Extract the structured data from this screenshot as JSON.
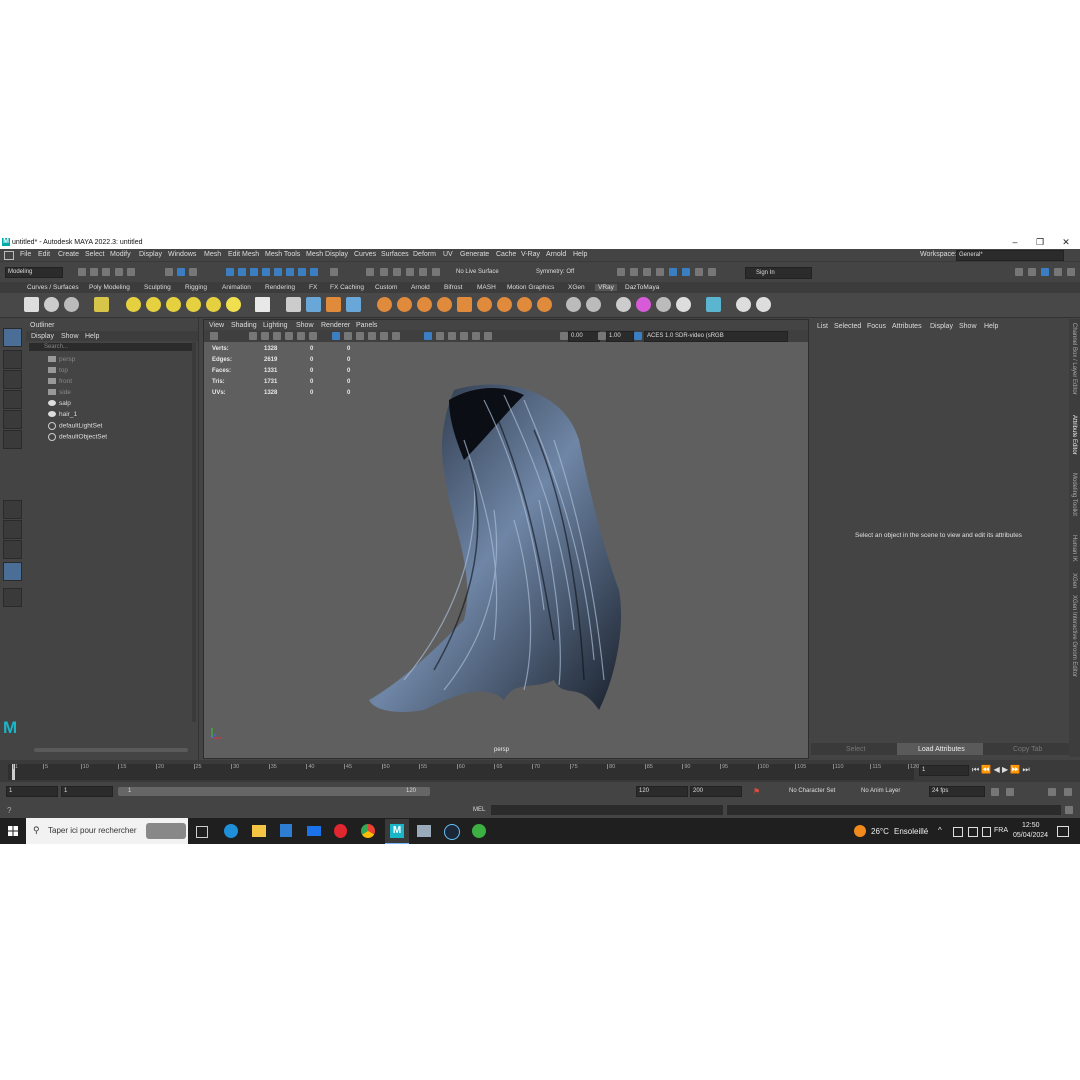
{
  "window": {
    "title": "untitled* - Autodesk MAYA 2022.3: untitled",
    "logo": "M",
    "controls": [
      "–",
      "❐",
      "✕"
    ]
  },
  "menubar": {
    "items": [
      "File",
      "Edit",
      "Create",
      "Select",
      "Modify",
      "Display",
      "Windows",
      "Mesh",
      "Edit Mesh",
      "Mesh Tools",
      "Mesh Display",
      "Curves",
      "Surfaces",
      "Deform",
      "UV",
      "Generate",
      "Cache",
      "V-Ray",
      "Arnold",
      "Help"
    ],
    "workspace_label": "Workspace:",
    "workspace_value": "General*"
  },
  "statusline": {
    "mode": "Modeling",
    "live_surface": "No Live Surface",
    "symmetry": "Symmetry: Off",
    "sign_in": "Sign In"
  },
  "shelf": {
    "tabs": [
      "Curves / Surfaces",
      "Poly Modeling",
      "Sculpting",
      "Rigging",
      "Animation",
      "Rendering",
      "FX",
      "FX Caching",
      "Custom",
      "Arnold",
      "Bifrost",
      "MASH",
      "Motion Graphics",
      "XGen",
      "VRay",
      "DazToMaya"
    ],
    "active_tab": "VRay"
  },
  "outliner": {
    "title": "Outliner",
    "menus": [
      "Display",
      "Show",
      "Help"
    ],
    "search_placeholder": "Search...",
    "items": [
      {
        "label": "persp",
        "dim": true,
        "icon": "camera-icon"
      },
      {
        "label": "top",
        "dim": true,
        "icon": "camera-icon"
      },
      {
        "label": "front",
        "dim": true,
        "icon": "camera-icon"
      },
      {
        "label": "side",
        "dim": true,
        "icon": "camera-icon"
      },
      {
        "label": "salp",
        "dim": false,
        "icon": "mesh-icon"
      },
      {
        "label": "hair_1",
        "dim": false,
        "icon": "mesh-icon"
      },
      {
        "label": "defaultLightSet",
        "dim": false,
        "icon": "set-icon"
      },
      {
        "label": "defaultObjectSet",
        "dim": false,
        "icon": "set-icon"
      }
    ]
  },
  "viewport": {
    "menus": [
      "View",
      "Shading",
      "Lighting",
      "Show",
      "Renderer",
      "Panels"
    ],
    "value_a": "0.00",
    "value_b": "1.00",
    "color_space": "ACES 1.0 SDR-video (sRGB",
    "camera_label": "persp",
    "hud": [
      {
        "label": "Verts:",
        "v1": "1328",
        "v2": "0",
        "v3": "0"
      },
      {
        "label": "Edges:",
        "v1": "2619",
        "v2": "0",
        "v3": "0"
      },
      {
        "label": "Faces:",
        "v1": "1331",
        "v2": "0",
        "v3": "0"
      },
      {
        "label": "Tris:",
        "v1": "1731",
        "v2": "0",
        "v3": "0"
      },
      {
        "label": "UVs:",
        "v1": "1328",
        "v2": "0",
        "v3": "0"
      }
    ]
  },
  "attribute_editor": {
    "menus": [
      "List",
      "Selected",
      "Focus",
      "Attributes",
      "Display",
      "Show",
      "Help"
    ],
    "message": "Select an object in the scene to view and edit its attributes",
    "bottom_buttons": [
      "Select",
      "Load Attributes",
      "Copy Tab"
    ]
  },
  "side_tabs": [
    "Channel Box / Layer Editor",
    "Attribute Editor",
    "Modeling Toolkit",
    "Human IK",
    "XGen",
    "XGen Interactive Groom Editor"
  ],
  "timeline": {
    "ticks": [
      "1",
      "5",
      "10",
      "15",
      "20",
      "25",
      "30",
      "35",
      "40",
      "45",
      "50",
      "55",
      "60",
      "65",
      "70",
      "75",
      "80",
      "85",
      "90",
      "95",
      "100",
      "105",
      "110",
      "115",
      "120"
    ],
    "current_frame": "1",
    "start": "1",
    "start_inner": "1",
    "range_start_label": "1",
    "range_end_label": "120",
    "end_inner": "120",
    "end": "200",
    "character_set": "No Character Set",
    "anim_layer": "No Anim Layer",
    "fps": "24 fps"
  },
  "cmdline": {
    "label": "MEL"
  },
  "taskbar": {
    "search_placeholder": "Taper ici pour rechercher",
    "weather_temp": "26°C",
    "weather_text": "Ensoleillé",
    "lang": "FRA",
    "time": "12:50",
    "date": "05/04/2024"
  },
  "colors": {
    "maya_bg": "#444444",
    "viewport_bg": "#5f5f5f",
    "selected_blue": "#4b6e96",
    "hair_color": "#8aa0bf"
  }
}
